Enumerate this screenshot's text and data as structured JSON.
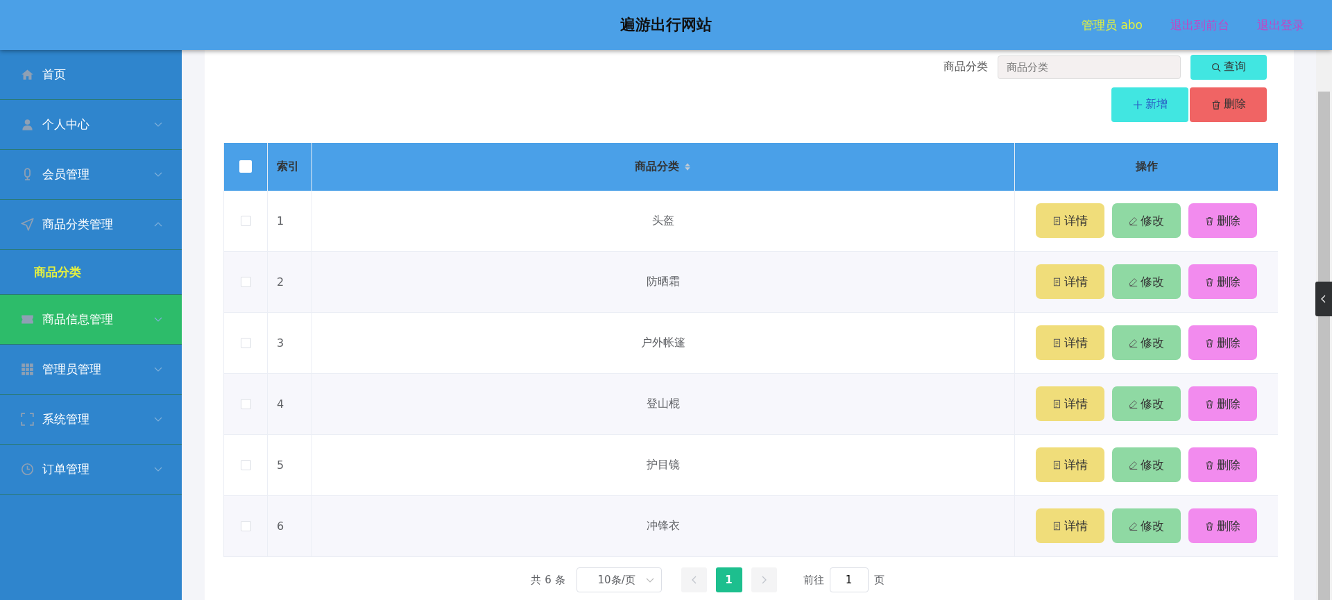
{
  "header": {
    "title": "遍游出行网站",
    "user": "管理员 abo",
    "links": [
      "退出到前台",
      "退出登录"
    ]
  },
  "sidebar": {
    "items": [
      {
        "label": "首页",
        "selected": false,
        "highlighted": false
      },
      {
        "label": "个人中心",
        "selected": false,
        "highlighted": false,
        "expanded": false
      },
      {
        "label": "会员管理",
        "selected": false,
        "highlighted": false,
        "expanded": false
      },
      {
        "label": "商品分类管理",
        "selected": false,
        "highlighted": false,
        "expanded": true,
        "children": [
          {
            "label": "商品分类",
            "selected": true
          }
        ]
      },
      {
        "label": "商品信息管理",
        "selected": false,
        "highlighted": true,
        "expanded": false
      },
      {
        "label": "管理员管理",
        "selected": false,
        "highlighted": false,
        "expanded": false
      },
      {
        "label": "系统管理",
        "selected": false,
        "highlighted": false,
        "expanded": false
      },
      {
        "label": "订单管理",
        "selected": false,
        "highlighted": false,
        "expanded": false
      }
    ]
  },
  "search": {
    "label": "商品分类",
    "placeholder": "商品分类",
    "button": "查询"
  },
  "toolbar": [
    {
      "label": "新增",
      "kind": "add"
    },
    {
      "label": "删除",
      "kind": "delete"
    }
  ],
  "table": {
    "select_all_checked": false,
    "columns": [
      {
        "label": "索引",
        "sortable": false
      },
      {
        "label": "商品分类",
        "sortable": true
      },
      {
        "label": "操作",
        "sortable": false
      }
    ],
    "rows": [
      {
        "checked": false,
        "index": "1",
        "category": "头盔",
        "actions": [
          {
            "label": "详情",
            "kind": "detail"
          },
          {
            "label": "修改",
            "kind": "edit"
          },
          {
            "label": "删除",
            "kind": "delete"
          }
        ]
      },
      {
        "checked": false,
        "index": "2",
        "category": "防晒霜",
        "actions": [
          {
            "label": "详情",
            "kind": "detail"
          },
          {
            "label": "修改",
            "kind": "edit"
          },
          {
            "label": "删除",
            "kind": "delete"
          }
        ]
      },
      {
        "checked": false,
        "index": "3",
        "category": "户外帐篷",
        "actions": [
          {
            "label": "详情",
            "kind": "detail"
          },
          {
            "label": "修改",
            "kind": "edit"
          },
          {
            "label": "删除",
            "kind": "delete"
          }
        ]
      },
      {
        "checked": false,
        "index": "4",
        "category": "登山棍",
        "actions": [
          {
            "label": "详情",
            "kind": "detail"
          },
          {
            "label": "修改",
            "kind": "edit"
          },
          {
            "label": "删除",
            "kind": "delete"
          }
        ]
      },
      {
        "checked": false,
        "index": "5",
        "category": "护目镜",
        "actions": [
          {
            "label": "详情",
            "kind": "detail"
          },
          {
            "label": "修改",
            "kind": "edit"
          },
          {
            "label": "删除",
            "kind": "delete"
          }
        ]
      },
      {
        "checked": false,
        "index": "6",
        "category": "冲锋衣",
        "actions": [
          {
            "label": "详情",
            "kind": "detail"
          },
          {
            "label": "修改",
            "kind": "edit"
          },
          {
            "label": "删除",
            "kind": "delete"
          }
        ]
      }
    ]
  },
  "pagination": {
    "total": "共 6 条",
    "page_size": "10条/页",
    "prev_disabled": true,
    "next_disabled": true,
    "pages": [
      {
        "label": "1",
        "selected": true
      }
    ],
    "goto_label": "前往",
    "goto_value": "1",
    "goto_suffix": "页"
  }
}
